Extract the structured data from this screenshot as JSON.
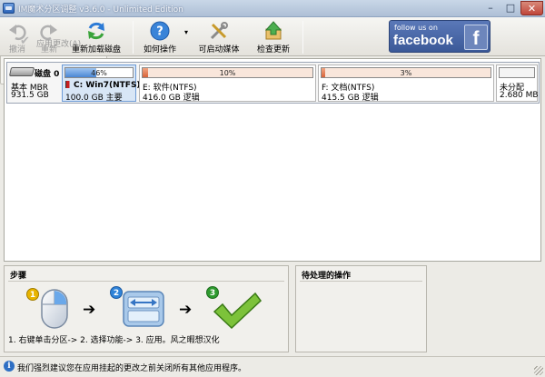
{
  "window": {
    "title": "IM魔术分区调整 v3.6.0 - Unlimited Edition",
    "min": "–",
    "max": "□",
    "close": "✕"
  },
  "toolbar": {
    "undo": "撤消",
    "redo": "重新",
    "reload": "重新加载磁盘",
    "howto": "如何操作",
    "bootable": "可启动媒体",
    "update": "检查更新",
    "howto_dropdown": "▾"
  },
  "facebook": {
    "small": "follow us on",
    "big": "facebook",
    "f": "f"
  },
  "disk": {
    "name": "磁盘 0",
    "type": "基本 MBR",
    "size": "931.5 GB",
    "partitions": [
      {
        "pct_label": "46%",
        "used": 0.46,
        "name": "C: Win7(NTFS)",
        "info": "100.0 GB 主要",
        "kind": "primary"
      },
      {
        "pct_label": "10%",
        "used": 0.03,
        "name": "E: 软件(NTFS)",
        "info": "416.0 GB 逻辑",
        "kind": "logical"
      },
      {
        "pct_label": "3%",
        "used": 0.02,
        "name": "F: 文档(NTFS)",
        "info": "415.5 GB 逻辑",
        "kind": "logical"
      },
      {
        "pct_label": "",
        "used": 0,
        "name": "未分配",
        "info": "2.680 MB",
        "kind": "unalloc"
      }
    ]
  },
  "steps": {
    "title": "步骤",
    "n1": "1",
    "n2": "2",
    "n3": "3",
    "arrow1": "➔",
    "arrow2": "➔",
    "text": "1. 右键单击分区-> 2. 选择功能-> 3. 应用。风之暇想汉化"
  },
  "pending": {
    "title": "待处理的操作"
  },
  "apply": {
    "label": "应用更改(A)",
    "check": "✔"
  },
  "status": {
    "icon": "i",
    "text": "我们强烈建议您在应用挂起的更改之前关闭所有其他应用程序。"
  }
}
